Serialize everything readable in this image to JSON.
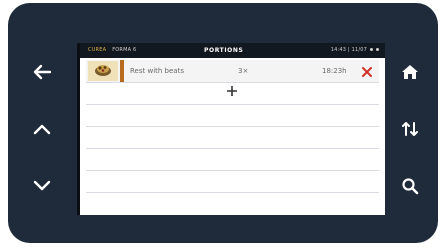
{
  "status_bar": {
    "left_primary": "CUREA",
    "left_secondary": "FORMA 6",
    "title": "PORTIONS",
    "right": "14:43 | 11/07"
  },
  "portions": [
    {
      "name": "Rest with beats",
      "qty": "3×",
      "time": "18:23h"
    }
  ],
  "add_label": "+",
  "colors": {
    "device": "#1f2b3a",
    "accent": "#b86a1f",
    "delete": "#d0312d"
  },
  "icons": {
    "left": [
      "arrow-left-icon",
      "chevron-up-icon",
      "chevron-down-icon"
    ],
    "right": [
      "home-icon",
      "sort-icon",
      "search-icon"
    ]
  }
}
